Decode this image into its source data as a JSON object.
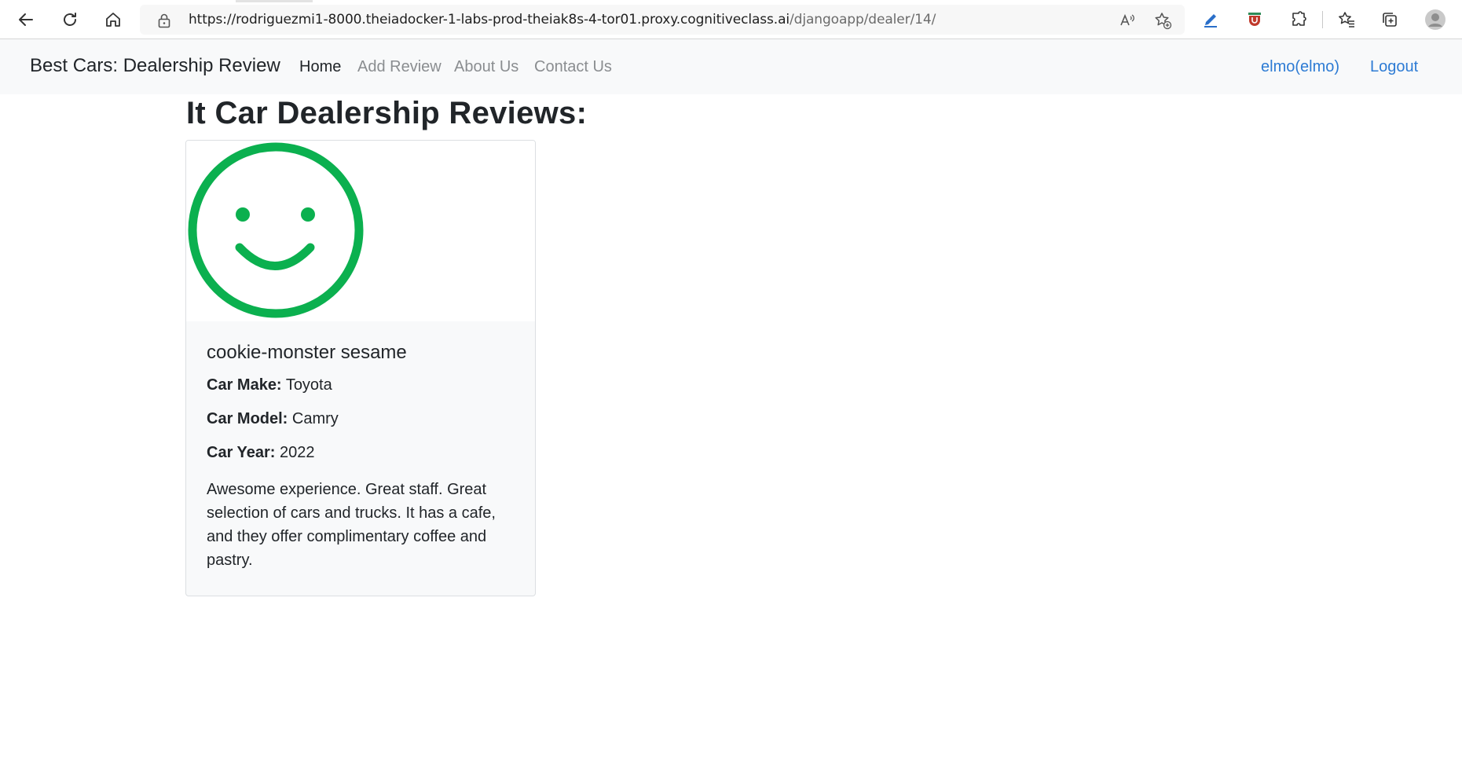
{
  "browser": {
    "url_host": "https://rodriguezmi1-8000.theiadocker-1-labs-prod-theiak8s-4-tor01.proxy.cognitiveclass.ai",
    "url_path": "/djangoapp/dealer/14/"
  },
  "navbar": {
    "brand": "Best Cars: Dealership Review",
    "links": [
      {
        "label": "Home",
        "active": true
      },
      {
        "label": "Add Review",
        "active": false
      },
      {
        "label": "About Us",
        "active": false
      },
      {
        "label": "Contact Us",
        "active": false
      }
    ],
    "user": "elmo(elmo)",
    "logout": "Logout"
  },
  "page": {
    "title": "It Car Dealership Reviews:"
  },
  "reviews": [
    {
      "sentiment_icon": "smiley-face-icon",
      "sentiment_color": "#0bb04f",
      "name": "cookie-monster sesame",
      "car_make_label": "Car Make:",
      "car_make": "Toyota",
      "car_model_label": "Car Model:",
      "car_model": "Camry",
      "car_year_label": "Car Year:",
      "car_year": "2022",
      "text": "Awesome experience. Great staff. Great selection of cars and trucks. It has a cafe, and they offer complimentary coffee and pastry."
    }
  ],
  "colors": {
    "nav_bg": "#f8f9fa",
    "link_blue": "#2d7bd4",
    "positive_green": "#0bb04f"
  }
}
